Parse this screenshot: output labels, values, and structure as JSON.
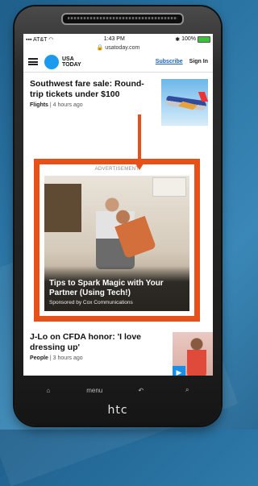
{
  "status_bar": {
    "carrier": "AT&T",
    "time": "1:43 PM",
    "battery": "100%"
  },
  "browser": {
    "url": "usatoday.com"
  },
  "header": {
    "logo_line1": "USA",
    "logo_line2": "TODAY",
    "subscribe": "Subscribe",
    "signin": "Sign In"
  },
  "story1": {
    "headline": "Southwest fare sale: Round-trip tickets under $100",
    "section": "Flights",
    "time": "4 hours ago"
  },
  "ad": {
    "label": "ADVERTISEMENT",
    "title": "Tips to Spark Magic with Your Partner (Using Tech!)",
    "sponsor": "Sponsored by Cox Communications"
  },
  "story2": {
    "headline": "J-Lo on CFDA honor: 'I love dressing up'",
    "section": "People",
    "time": "3 hours ago"
  },
  "phone": {
    "menu_label": "menu",
    "brand": "htc"
  },
  "colors": {
    "highlight": "#e8501a",
    "logo": "#1a9bf0",
    "subscribe": "#1a5fb4"
  }
}
